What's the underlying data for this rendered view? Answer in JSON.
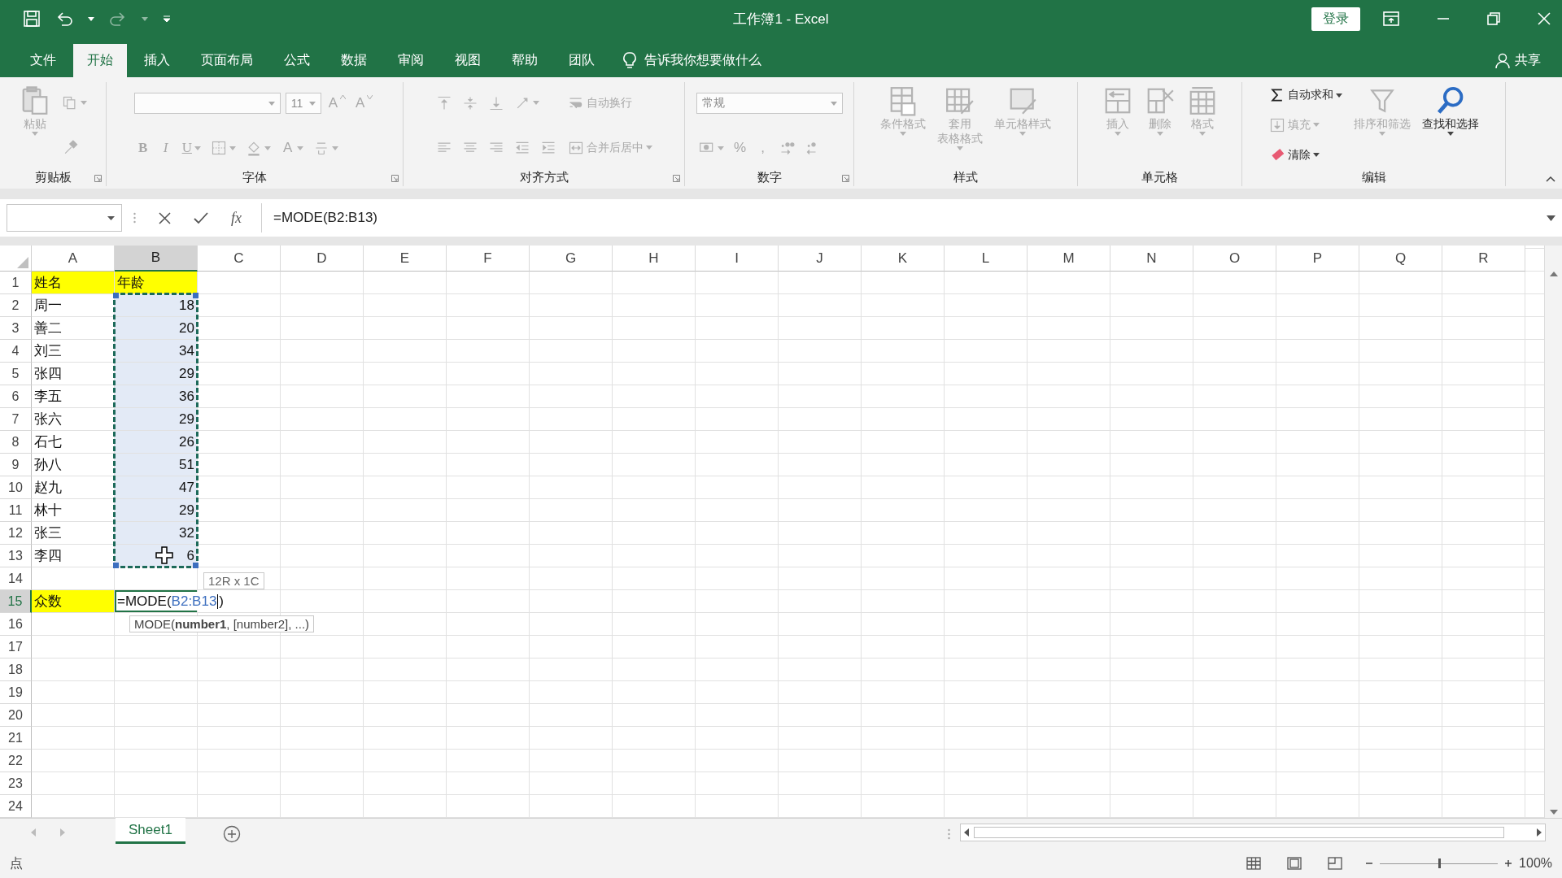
{
  "window": {
    "title": "工作簿1 - Excel",
    "login_button": "登录"
  },
  "ribbon_tabs": [
    {
      "label": "文件",
      "selected": false
    },
    {
      "label": "开始",
      "selected": true
    },
    {
      "label": "插入",
      "selected": false
    },
    {
      "label": "页面布局",
      "selected": false
    },
    {
      "label": "公式",
      "selected": false
    },
    {
      "label": "数据",
      "selected": false
    },
    {
      "label": "审阅",
      "selected": false
    },
    {
      "label": "视图",
      "selected": false
    },
    {
      "label": "帮助",
      "selected": false
    },
    {
      "label": "团队",
      "selected": false
    }
  ],
  "tell_me": "告诉我你想要做什么",
  "share": "共享",
  "ribbon": {
    "groups": [
      {
        "label": "剪贴板",
        "launcher": true,
        "columns": [
          [
            {
              "kind": "large",
              "label": "粘贴",
              "caret": true,
              "disabled": true
            }
          ],
          [
            {
              "kind": "icon",
              "caret": true,
              "disabled": true
            },
            {
              "kind": "icon",
              "caret": false,
              "disabled": true
            }
          ]
        ]
      },
      {
        "label": "字体",
        "launcher": true,
        "columns": [
          [
            {
              "kind": "row",
              "items": [
                {
                  "kind": "wide-combo",
                  "disabled": true
                },
                {
                  "kind": "narrow-combo",
                  "value": "11",
                  "disabled": true
                },
                {
                  "kind": "grow-font",
                  "label": "A",
                  "disabled": true
                },
                {
                  "kind": "shrink-font",
                  "label": "A",
                  "disabled": true
                }
              ]
            },
            {
              "kind": "row",
              "items": [
                {
                  "kind": "bold",
                  "label": "B",
                  "caret": false,
                  "disabled": true
                },
                {
                  "kind": "italic",
                  "label": "I",
                  "caret": false,
                  "disabled": true
                },
                {
                  "kind": "underline",
                  "label": "U",
                  "caret": true,
                  "disabled": true
                },
                {
                  "kind": "icon",
                  "caret": true,
                  "disabled": true
                },
                {
                  "kind": "icon",
                  "caret": true,
                  "disabled": true
                },
                {
                  "kind": "font-color",
                  "label": "A",
                  "caret": true,
                  "disabled": true
                },
                {
                  "kind": "icon",
                  "caret": true,
                  "disabled": true
                }
              ]
            }
          ]
        ]
      },
      {
        "label": "对齐方式",
        "launcher": true,
        "columns": [
          [
            {
              "kind": "row",
              "items": [
                {
                  "kind": "icon",
                  "caret": false,
                  "disabled": true
                },
                {
                  "kind": "icon",
                  "caret": false,
                  "disabled": true
                },
                {
                  "kind": "icon",
                  "caret": false,
                  "disabled": true
                },
                {
                  "kind": "icon",
                  "caret": true,
                  "disabled": true
                }
              ]
            },
            {
              "kind": "row",
              "items": [
                {
                  "kind": "icon",
                  "caret": false,
                  "disabled": true
                },
                {
                  "kind": "icon",
                  "caret": false,
                  "disabled": true
                },
                {
                  "kind": "icon",
                  "caret": false,
                  "disabled": true
                },
                {
                  "kind": "icon",
                  "caret": false,
                  "disabled": true
                },
                {
                  "kind": "icon",
                  "caret": false,
                  "disabled": true
                }
              ]
            }
          ],
          [
            {
              "kind": "small",
              "label": "自动换行",
              "caret": false,
              "disabled": true
            },
            {
              "kind": "small",
              "label": "合并后居中",
              "caret": true,
              "disabled": true
            }
          ]
        ]
      },
      {
        "label": "数字",
        "launcher": true,
        "columns": [
          [
            {
              "kind": "wide-combo",
              "value": "常规",
              "disabled": true
            },
            {
              "kind": "row",
              "items": [
                {
                  "kind": "icon",
                  "caret": true,
                  "disabled": true
                },
                {
                  "kind": "glyph",
                  "label": "%",
                  "caret": false,
                  "disabled": true
                },
                {
                  "kind": "glyph",
                  "label": ",",
                  "caret": false,
                  "disabled": true
                },
                {
                  "kind": "icon",
                  "caret": false,
                  "disabled": true
                },
                {
                  "kind": "icon",
                  "caret": false,
                  "disabled": true
                }
              ]
            }
          ]
        ]
      },
      {
        "label": "样式",
        "launcher": false,
        "columns": [
          [
            {
              "kind": "large",
              "label": "条件格式",
              "caret": true,
              "disabled": true
            }
          ],
          [
            {
              "kind": "large",
              "lines": [
                "套用",
                "表格格式"
              ],
              "caret": true,
              "disabled": true
            }
          ],
          [
            {
              "kind": "large",
              "label": "单元格样式",
              "caret": true,
              "disabled": true
            }
          ]
        ]
      },
      {
        "label": "单元格",
        "launcher": false,
        "columns": [
          [
            {
              "kind": "large",
              "label": "插入",
              "caret": true,
              "disabled": true
            }
          ],
          [
            {
              "kind": "large",
              "label": "删除",
              "caret": true,
              "disabled": true
            }
          ],
          [
            {
              "kind": "large",
              "label": "格式",
              "caret": true,
              "disabled": true
            }
          ]
        ]
      },
      {
        "label": "编辑",
        "launcher": false,
        "columns": [
          [
            {
              "kind": "small",
              "label": "自动求和",
              "caret": true,
              "disabled": false
            },
            {
              "kind": "small",
              "label": "填充",
              "caret": true,
              "disabled": true
            },
            {
              "kind": "small",
              "label": "清除",
              "caret": true,
              "disabled": false
            }
          ],
          [
            {
              "kind": "large",
              "label": "排序和筛选",
              "caret": true,
              "disabled": true
            }
          ],
          [
            {
              "kind": "large",
              "label": "查找和选择",
              "caret": true,
              "disabled": false
            }
          ]
        ]
      }
    ]
  },
  "formula_bar": {
    "function_button": "fx",
    "formula": "=MODE(B2:B13)"
  },
  "sheet": {
    "columns": [
      {
        "label": "A",
        "selected": false
      },
      {
        "label": "B",
        "selected": true
      },
      {
        "label": "C",
        "selected": false
      },
      {
        "label": "D",
        "selected": false
      },
      {
        "label": "E",
        "selected": false
      },
      {
        "label": "F",
        "selected": false
      },
      {
        "label": "G",
        "selected": false
      },
      {
        "label": "H",
        "selected": false
      },
      {
        "label": "I",
        "selected": false
      },
      {
        "label": "J",
        "selected": false
      },
      {
        "label": "K",
        "selected": false
      },
      {
        "label": "L",
        "selected": false
      },
      {
        "label": "M",
        "selected": false
      },
      {
        "label": "N",
        "selected": false
      },
      {
        "label": "O",
        "selected": false
      },
      {
        "label": "P",
        "selected": false
      },
      {
        "label": "Q",
        "selected": false
      },
      {
        "label": "R",
        "selected": false
      }
    ],
    "rows": [
      {
        "label": "1",
        "selected": false,
        "cells": [
          {
            "kind": "text",
            "text": "姓名",
            "highlighted": true,
            "in_range": false
          },
          {
            "kind": "text",
            "text": "年龄",
            "highlighted": true,
            "in_range": false
          }
        ]
      },
      {
        "label": "2",
        "selected": false,
        "cells": [
          {
            "kind": "text",
            "text": "周一",
            "highlighted": false,
            "in_range": false
          },
          {
            "kind": "number",
            "text": "18",
            "highlighted": false,
            "in_range": true
          }
        ]
      },
      {
        "label": "3",
        "selected": false,
        "cells": [
          {
            "kind": "text",
            "text": "善二",
            "highlighted": false,
            "in_range": false
          },
          {
            "kind": "number",
            "text": "20",
            "highlighted": false,
            "in_range": true
          }
        ]
      },
      {
        "label": "4",
        "selected": false,
        "cells": [
          {
            "kind": "text",
            "text": "刘三",
            "highlighted": false,
            "in_range": false
          },
          {
            "kind": "number",
            "text": "34",
            "highlighted": false,
            "in_range": true
          }
        ]
      },
      {
        "label": "5",
        "selected": false,
        "cells": [
          {
            "kind": "text",
            "text": "张四",
            "highlighted": false,
            "in_range": false
          },
          {
            "kind": "number",
            "text": "29",
            "highlighted": false,
            "in_range": true
          }
        ]
      },
      {
        "label": "6",
        "selected": false,
        "cells": [
          {
            "kind": "text",
            "text": "李五",
            "highlighted": false,
            "in_range": false
          },
          {
            "kind": "number",
            "text": "36",
            "highlighted": false,
            "in_range": true
          }
        ]
      },
      {
        "label": "7",
        "selected": false,
        "cells": [
          {
            "kind": "text",
            "text": "张六",
            "highlighted": false,
            "in_range": false
          },
          {
            "kind": "number",
            "text": "29",
            "highlighted": false,
            "in_range": true
          }
        ]
      },
      {
        "label": "8",
        "selected": false,
        "cells": [
          {
            "kind": "text",
            "text": "石七",
            "highlighted": false,
            "in_range": false
          },
          {
            "kind": "number",
            "text": "26",
            "highlighted": false,
            "in_range": true
          }
        ]
      },
      {
        "label": "9",
        "selected": false,
        "cells": [
          {
            "kind": "text",
            "text": "孙八",
            "highlighted": false,
            "in_range": false
          },
          {
            "kind": "number",
            "text": "51",
            "highlighted": false,
            "in_range": true
          }
        ]
      },
      {
        "label": "10",
        "selected": false,
        "cells": [
          {
            "kind": "text",
            "text": "赵九",
            "highlighted": false,
            "in_range": false
          },
          {
            "kind": "number",
            "text": "47",
            "highlighted": false,
            "in_range": true
          }
        ]
      },
      {
        "label": "11",
        "selected": false,
        "cells": [
          {
            "kind": "text",
            "text": "林十",
            "highlighted": false,
            "in_range": false
          },
          {
            "kind": "number",
            "text": "29",
            "highlighted": false,
            "in_range": true
          }
        ]
      },
      {
        "label": "12",
        "selected": false,
        "cells": [
          {
            "kind": "text",
            "text": "张三",
            "highlighted": false,
            "in_range": false
          },
          {
            "kind": "number",
            "text": "32",
            "highlighted": false,
            "in_range": true
          }
        ]
      },
      {
        "label": "13",
        "selected": false,
        "cells": [
          {
            "kind": "text",
            "text": "李四",
            "highlighted": false,
            "in_range": false
          },
          {
            "kind": "number",
            "text": "6",
            "highlighted": false,
            "in_range": true,
            "cursor": true
          }
        ]
      },
      {
        "label": "14",
        "selected": false,
        "cells": []
      },
      {
        "label": "15",
        "selected": true,
        "cells": [
          {
            "kind": "text",
            "text": "众数",
            "highlighted": true,
            "in_range": false
          },
          {
            "kind": "formula",
            "prefix": "=MODE(",
            "reference": "B2:B13",
            "suffix": ")"
          }
        ]
      },
      {
        "label": "16",
        "selected": false,
        "cells": []
      },
      {
        "label": "17",
        "selected": false,
        "cells": []
      },
      {
        "label": "18",
        "selected": false,
        "cells": []
      },
      {
        "label": "19",
        "selected": false,
        "cells": []
      },
      {
        "label": "20",
        "selected": false,
        "cells": []
      },
      {
        "label": "21",
        "selected": false,
        "cells": []
      },
      {
        "label": "22",
        "selected": false,
        "cells": []
      },
      {
        "label": "23",
        "selected": false,
        "cells": []
      },
      {
        "label": "24",
        "selected": false,
        "cells": []
      }
    ],
    "range_tooltip": "12R x 1C",
    "function_tooltip": "MODE(**number1**, [number2], ...)"
  },
  "sheet_tabs": [
    {
      "label": "Sheet1",
      "selected": true
    }
  ],
  "status_bar": {
    "mode": "点",
    "zoom_slider": {
      "level": 0.5
    },
    "zoom": "100%"
  }
}
